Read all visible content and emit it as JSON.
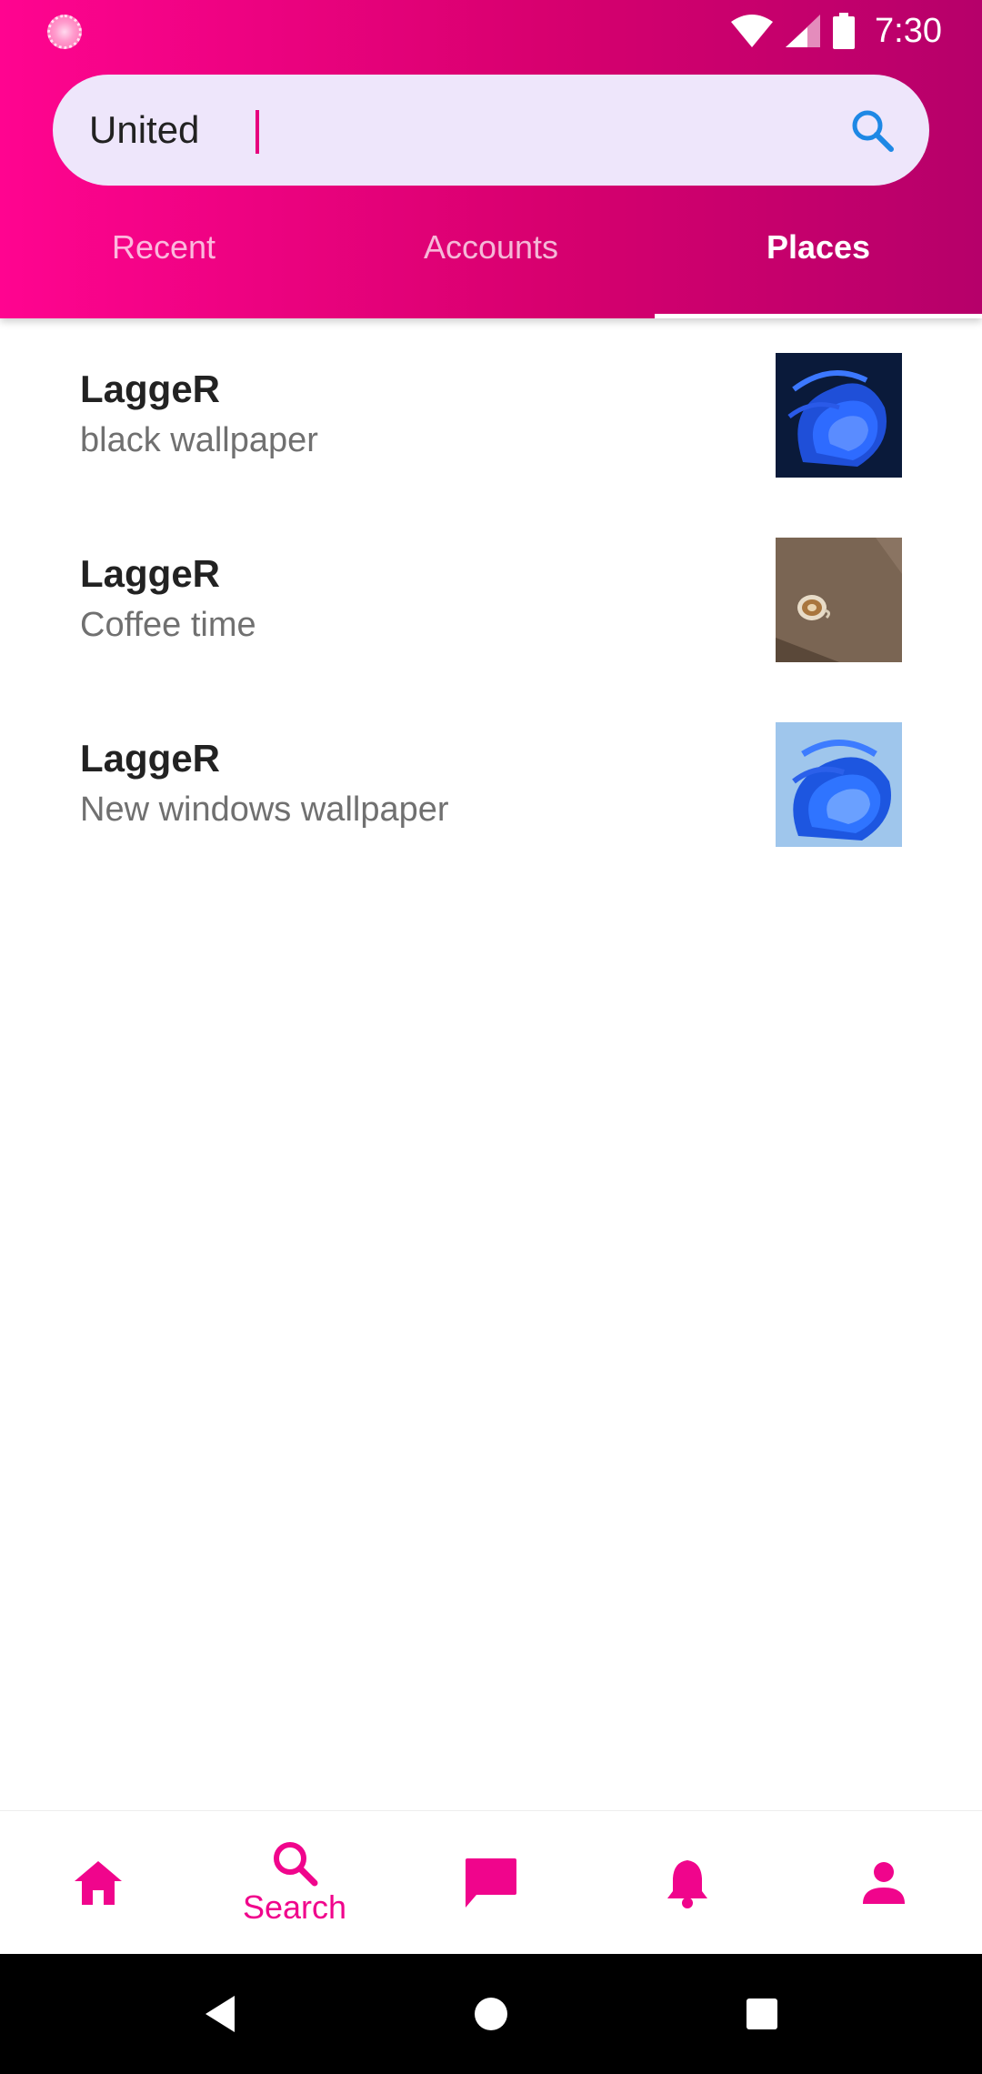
{
  "status_bar": {
    "time": "7:30",
    "icons": [
      "app-notification-icon",
      "wifi-icon",
      "cellular-signal-icon",
      "battery-icon"
    ]
  },
  "search": {
    "query": "United",
    "icon": "search-icon"
  },
  "tabs": [
    {
      "label": "Recent",
      "active": false
    },
    {
      "label": "Accounts",
      "active": false
    },
    {
      "label": "Places",
      "active": true
    }
  ],
  "results": [
    {
      "title": "LaggeR",
      "subtitle": "black wallpaper",
      "thumbnail": "dark blue abstract wallpaper"
    },
    {
      "title": "LaggeR",
      "subtitle": "Coffee time",
      "thumbnail": "coffee cup photo"
    },
    {
      "title": "LaggeR",
      "subtitle": "New windows wallpaper",
      "thumbnail": "light blue bloom wallpaper"
    }
  ],
  "bottom_nav": {
    "items": [
      {
        "icon": "home-icon",
        "label": ""
      },
      {
        "icon": "search-icon",
        "label": "Search",
        "active": true
      },
      {
        "icon": "chat-icon",
        "label": ""
      },
      {
        "icon": "bell-icon",
        "label": ""
      },
      {
        "icon": "person-icon",
        "label": ""
      }
    ]
  },
  "colors": {
    "accent": "#f0058c",
    "header_gradient_start": "#ff0490",
    "header_gradient_end": "#b6006a",
    "search_bg": "#eee6fb",
    "search_icon": "#1e88e5"
  }
}
